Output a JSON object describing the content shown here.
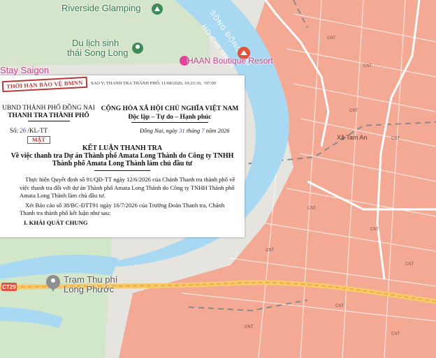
{
  "map": {
    "labels": {
      "riverside": "Riverside Glamping",
      "du_lich_1": "Du lịch sinh",
      "du_lich_2": "thái Song Long",
      "stay": "Stay Saigon",
      "haan": "HAAN Boutique Resort",
      "river": "SÔNG ĐỒNG NAI",
      "city": "HO CHI MINH",
      "tam_an": "Xã Tam An",
      "toll_1": "Trạm Thu phí",
      "toll_2": "Long Phước",
      "route": "CT29",
      "zoning_code": "CNT"
    },
    "colors": {
      "water": "#a9d9f2",
      "land": "#e6e4df",
      "urban": "#f4a995",
      "green": "#cde6c4",
      "road": "#f7c96a"
    }
  },
  "document": {
    "stamp_top": "THỜI HẠN BẢO VỆ BMNN",
    "sao_y": "SAO Y; THANH TRA THÀNH PHỐ; 11/08/2026; 10:23:16; +07:00",
    "org_line1": "UBND THÀNH PHỐ ĐỒNG NAI",
    "org_line2": "THANH TRA THÀNH PHỐ",
    "country_line1": "CỘNG HÒA XÃ HỘI CHỦ NGHĨA VIỆT NAM",
    "country_line2": "Độc lập – Tự do – Hạnh phúc",
    "number_prefix": "Số: ",
    "number_value": "26",
    "number_suffix": " /KL-TT",
    "date_prefix": "Đồng Nai, ngày ",
    "date_day": "31",
    "date_mid": " tháng ",
    "date_month": "7",
    "date_suffix": " năm 2026",
    "secret": "MẬT",
    "title": "KẾT LUẬN THANH TRA",
    "subtitle_1": "Về việc thanh tra Dự án Thành phố Amata Long Thành do Công ty TNHH",
    "subtitle_2": "Thành phố Amata Long Thành làm chủ đầu tư",
    "para1": "Thực hiện Quyết định số 91/QĐ-TT ngày 12/6/2026 của Chánh Thanh tra thành phố về việc thanh tra đối với dự án Thành phố Amata Long Thành do Công ty TNHH Thành phố Amata Long Thành làm chủ đầu tư.",
    "para2": "Xét Báo cáo số 38/BC-ĐTT91 ngày 16/7/2026 của Trưởng Đoàn Thanh tra, Chánh Thanh tra thành phố kết luận như sau:",
    "section1": "I. KHÁI QUÁT CHUNG"
  }
}
